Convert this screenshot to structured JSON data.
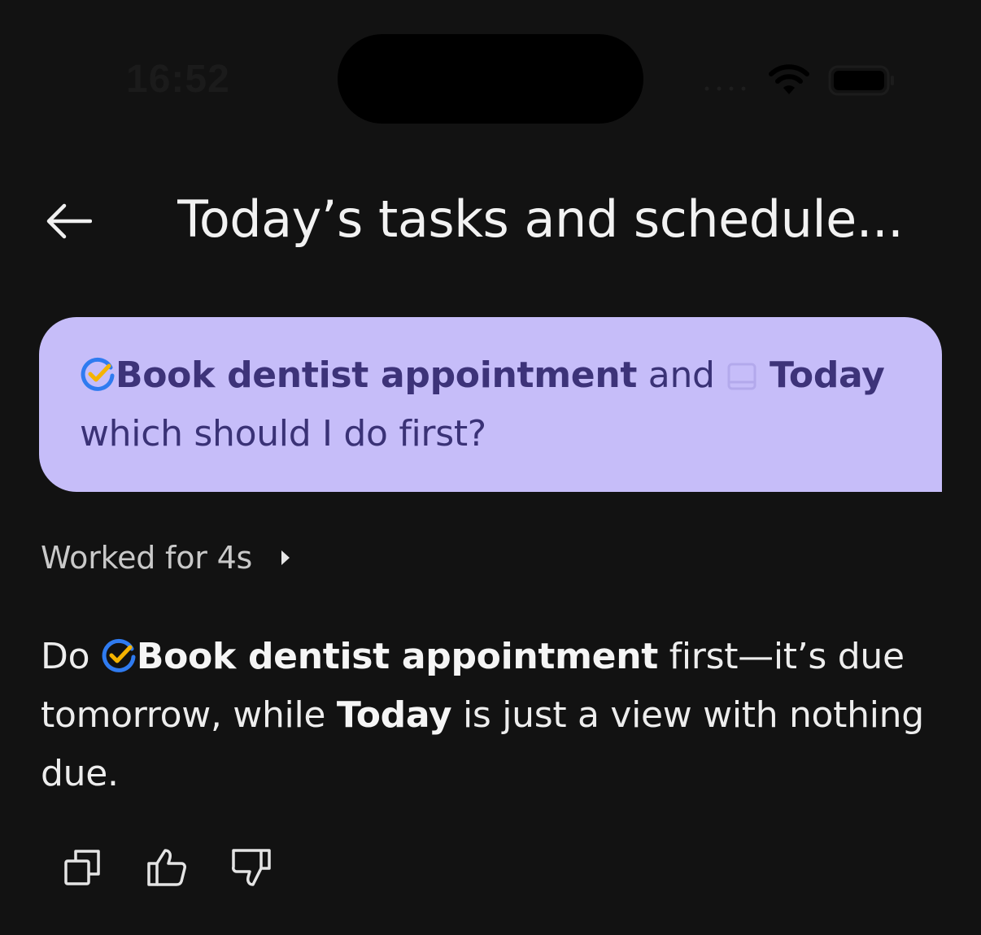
{
  "status_bar": {
    "time": "16:52"
  },
  "header": {
    "title": "Today’s tasks and schedule..."
  },
  "user_message": {
    "task_name": "Book dentist appointment",
    "connector": "and",
    "view_name": "Today",
    "question": "which should I do first?"
  },
  "worked_for": {
    "label": "Worked for 4s"
  },
  "answer": {
    "lead": "Do",
    "task_name": "Book dentist appointment",
    "after_task": "first—it’s due tomorrow, while",
    "view_name": "Today",
    "tail": "is just a view with nothing due."
  },
  "icons": {
    "back": "arrow-left-icon",
    "task": "task-check-icon",
    "view": "calendar-view-icon",
    "expand": "caret-right-icon",
    "copy": "copy-icon",
    "like": "thumbs-up-icon",
    "dislike": "thumbs-down-icon"
  },
  "colors": {
    "background": "#121212",
    "bubble": "#c6bdf9",
    "bubble_text": "#3d3379",
    "task_icon_blue": "#2f7bf0",
    "task_icon_check": "#f5b300"
  }
}
